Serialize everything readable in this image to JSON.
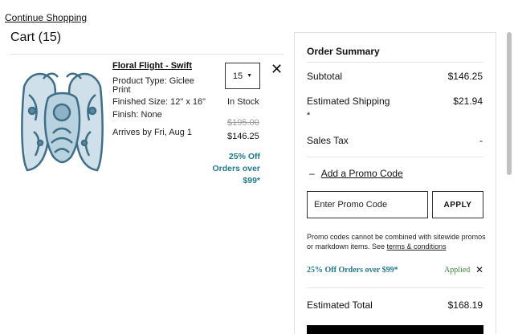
{
  "nav": {
    "continue_shopping": "Continue Shopping"
  },
  "cart": {
    "title": "Cart (15)",
    "item": {
      "image_icon": "artwork-thumbnail",
      "name": "Floral Flight - Swift",
      "product_type_line1": "Product Type: Giclee",
      "product_type_line2": "Print",
      "finished_size": "Finished Size: 12\" x 16\"",
      "finish": "Finish: None",
      "arrival": "Arrives by Fri, Aug 1",
      "quantity": "15",
      "stock_status": "In Stock",
      "original_price": "$195.00",
      "sale_price": "$146.25",
      "promo_badge": "25% Off Orders over $99*"
    }
  },
  "summary": {
    "title": "Order Summary",
    "subtotal_label": "Subtotal",
    "subtotal_value": "$146.25",
    "shipping_label": "Estimated Shipping",
    "shipping_asterisk": "*",
    "shipping_value": "$21.94",
    "tax_label": "Sales Tax",
    "tax_value": "-",
    "add_promo_symbol": "–",
    "add_promo_label": "Add a Promo Code",
    "promo_placeholder": "Enter Promo Code",
    "apply_label": "APPLY",
    "disclaimer_text": "Promo codes cannot be combined with sitewide promos or markdown items. See ",
    "disclaimer_link": "terms & conditions",
    "applied_promo_name": "25% Off Orders over $99*",
    "applied_status": "Applied",
    "remove_promo_symbol": "✕",
    "total_label": "Estimated Total",
    "total_value": "$168.19"
  },
  "colors": {
    "promo_teal": "#1f7a8c",
    "applied_green": "#3d8a3d",
    "checkout_button": "#000000"
  }
}
